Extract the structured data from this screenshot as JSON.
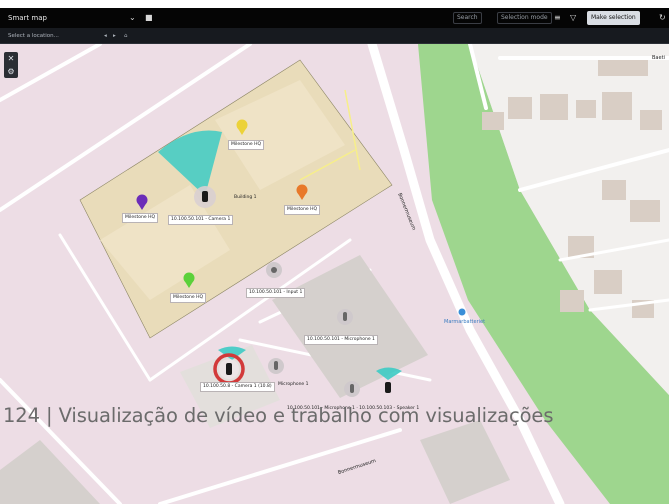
{
  "toolbar": {
    "title": "Smart map",
    "title_menu_icon": "chevron-down-icon",
    "camera_icon": "camera-icon",
    "search_label": "Search",
    "selection_label": "Selection mode",
    "layers_icon": "layers-icon",
    "filter_icon": "filter-icon",
    "primary_button_label": "Make selection",
    "refresh_icon": "refresh-icon"
  },
  "subtoolbar": {
    "location_label": "Select a location...",
    "home_icon": "home-icon"
  },
  "side_tools": {
    "close_icon": "close-icon",
    "settings_icon": "gear-icon"
  },
  "map": {
    "colors": {
      "background": "#eddde5",
      "building_zone": "#e8dcb3",
      "park": "#9ed68e",
      "road": "#ffffff",
      "coverage": "#3dcbc4",
      "alarm": "#d23a3a"
    },
    "street_label": "Bonnermuseum",
    "street_label_2": "Bonnermuseum",
    "north_label": "Baeti",
    "poi_label": "Marmarbatteriet",
    "markers": [
      {
        "label": "Milestone HQ",
        "color": "#ecd238"
      },
      {
        "label": "Milestone HQ",
        "color": "#6b2db8"
      },
      {
        "label": "Milestone HQ",
        "color": "#e8792a"
      },
      {
        "label": "Milestone HQ",
        "color": "#5bd13a"
      }
    ],
    "devices": [
      {
        "label": "10.100.50.101 - Camera 1"
      },
      {
        "label": "Building 1"
      },
      {
        "label": "10.100.50.101 - Input 1"
      },
      {
        "label": "10.100.50.101 - Microphone 1"
      },
      {
        "label": "10.100.50.8 - Camera 1 (10.8)"
      },
      {
        "label": "Microphone 1"
      },
      {
        "label": "10.100.50.101 - Microphone 1 · 10.100.50.103 - Speaker 1"
      }
    ],
    "device_icons": [
      "camera-icon",
      "microphone-icon",
      "input-icon",
      "speaker-icon"
    ]
  },
  "caption": "124 | Visualização de vídeo e trabalho com visualizações"
}
